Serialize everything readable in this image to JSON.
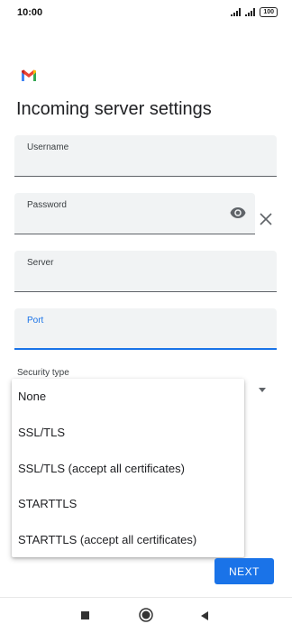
{
  "status_bar": {
    "time": "10:00",
    "battery": "100",
    "icons": [
      "signal-icon",
      "signal-icon",
      "battery-icon"
    ]
  },
  "app": {
    "logo": "gmail-logo",
    "title": "Incoming server settings"
  },
  "form": {
    "username": {
      "label": "Username",
      "value": ""
    },
    "password": {
      "label": "Password",
      "value": "",
      "icons": [
        "eye-icon",
        "clear-icon"
      ]
    },
    "server": {
      "label": "Server",
      "value": ""
    },
    "port": {
      "label": "Port",
      "value": "",
      "focused": true
    },
    "security_type": {
      "label": "Security type",
      "options": [
        "None",
        "SSL/TLS",
        "SSL/TLS (accept all certificates)",
        "STARTTLS",
        "STARTTLS (accept all certificates)"
      ]
    }
  },
  "actions": {
    "next_label": "NEXT"
  },
  "nav_bar": {
    "icons": [
      "recents-square-icon",
      "home-circle-icon",
      "back-triangle-icon"
    ]
  },
  "colors": {
    "accent": "#1a73e8",
    "field_bg": "#f1f3f4",
    "text": "#202124"
  }
}
